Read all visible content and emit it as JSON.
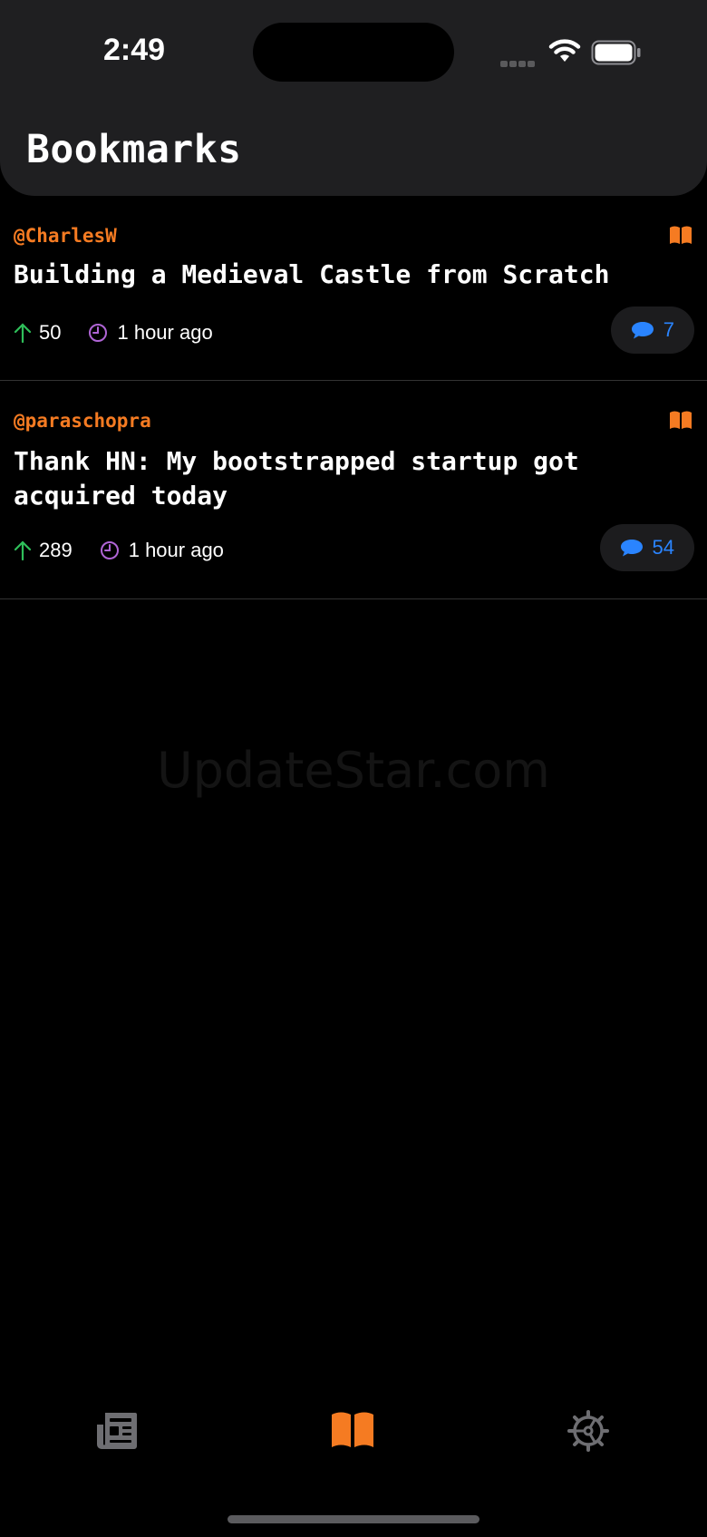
{
  "status_bar": {
    "time": "2:49"
  },
  "header": {
    "title": "Bookmarks"
  },
  "stories": [
    {
      "author": "@CharlesW",
      "title": "Building a Medieval Castle from Scratch",
      "score": "50",
      "time": "1 hour ago",
      "comments": "7"
    },
    {
      "author": "@paraschopra",
      "title": "Thank HN: My bootstrapped startup got acquired today",
      "score": "289",
      "time": "1 hour ago",
      "comments": "54"
    }
  ],
  "watermark": "UpdateStar.com",
  "tabs": [
    {
      "icon": "newspaper-icon",
      "active": false
    },
    {
      "icon": "book-open-icon",
      "active": true
    },
    {
      "icon": "gear-icon",
      "active": false
    }
  ],
  "colors": {
    "accent": "#f57b22",
    "comments": "#2a84ff",
    "upvote": "#2fbf5a",
    "clock": "#b065d6",
    "inactive_tab": "#6e6e72"
  }
}
